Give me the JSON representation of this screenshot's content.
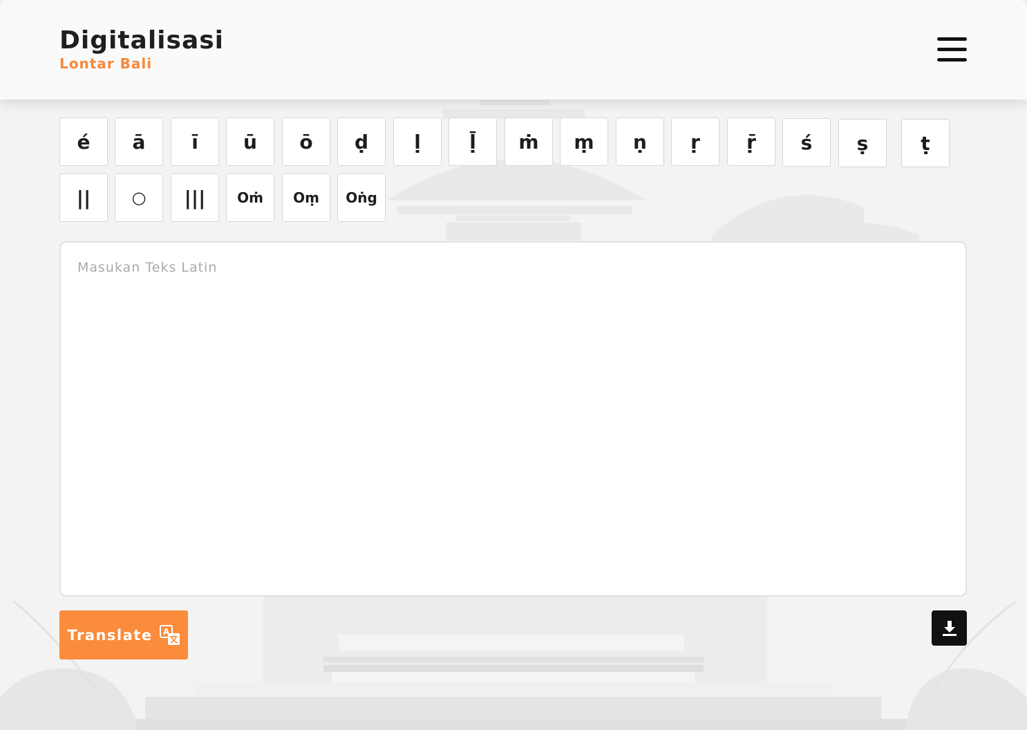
{
  "header": {
    "title": "Digitalisasi",
    "subtitle": "Lontar Bali",
    "menu_icon": "hamburger-menu-icon"
  },
  "keyboard": {
    "row1": [
      "é",
      "ā",
      "ī",
      "ū",
      "ō",
      "ḍ",
      "ḷ",
      "ḹ",
      "ṁ",
      "ṃ",
      "ṇ",
      "ṛ",
      "ṝ",
      "ś",
      "ṣ",
      "ṭ"
    ],
    "row2": [
      "||",
      "○",
      "|||",
      "Oṁ",
      "Oṃ",
      "Oṅg"
    ]
  },
  "input": {
    "placeholder": "Masukan Teks Latin",
    "value": ""
  },
  "actions": {
    "translate_label": "Translate",
    "translate_icon": "translate-icon",
    "download_icon": "download-icon"
  },
  "colors": {
    "accent": "#fa8c3b",
    "brand_sub": "#f5893a",
    "dark": "#111111"
  }
}
